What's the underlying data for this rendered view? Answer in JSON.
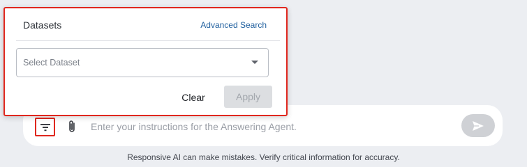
{
  "datasets_popover": {
    "title": "Datasets",
    "advanced_search_label": "Advanced Search",
    "select_placeholder": "Select Dataset",
    "clear_label": "Clear",
    "apply_label": "Apply"
  },
  "composer": {
    "input_placeholder": "Enter your instructions for the Answering Agent.",
    "filter_icon": "filter-icon",
    "attach_icon": "paperclip-icon",
    "send_icon": "send-icon"
  },
  "footer": {
    "disclaimer": "Responsive AI can make mistakes. Verify critical information for accuracy."
  },
  "colors": {
    "highlight": "#e0271e",
    "link": "#1f5f9e",
    "disabled_button": "#dcdee1"
  }
}
